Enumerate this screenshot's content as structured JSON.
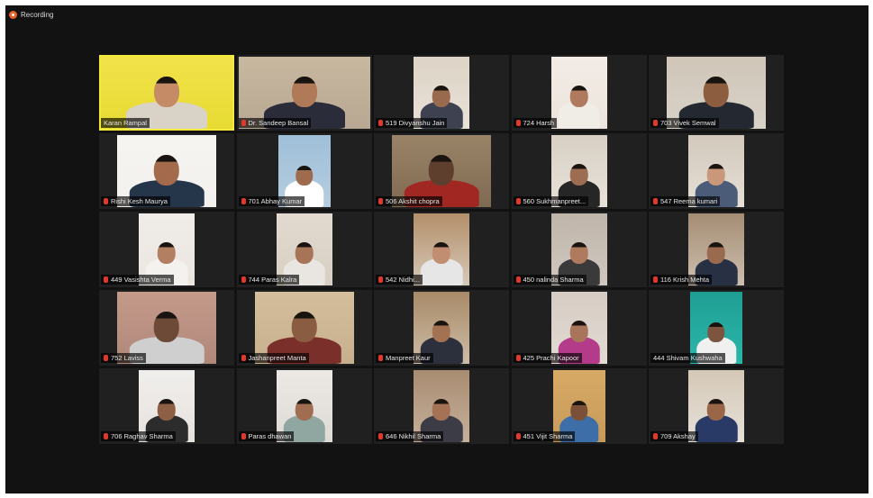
{
  "recording": {
    "label": "Recording",
    "color": "#e8622a"
  },
  "participants": [
    {
      "name": "Karan Rampal",
      "muted": false,
      "active": true
    },
    {
      "name": "Dr. Sandeep Bansal",
      "muted": true,
      "active": false
    },
    {
      "name": "519 Divyanshu Jain",
      "muted": true,
      "active": false
    },
    {
      "name": "724 Harsh",
      "muted": true,
      "active": false
    },
    {
      "name": "703 Vivek Semwal",
      "muted": true,
      "active": false
    },
    {
      "name": "Rishi Kesh Maurya",
      "muted": true,
      "active": false
    },
    {
      "name": "701 Abhay Kumar",
      "muted": true,
      "active": false
    },
    {
      "name": "506 Akshit chopra",
      "muted": true,
      "active": false
    },
    {
      "name": "560 Sukhmanpreet...",
      "muted": true,
      "active": false
    },
    {
      "name": "547 Reema kumari",
      "muted": true,
      "active": false
    },
    {
      "name": "449 Vasishta Verma",
      "muted": true,
      "active": false
    },
    {
      "name": "744 Paras Kalra",
      "muted": true,
      "active": false
    },
    {
      "name": "542 Nidhi...",
      "muted": true,
      "active": false
    },
    {
      "name": "450 nalinda Sharma",
      "muted": true,
      "active": false
    },
    {
      "name": "116 Krish Mehta",
      "muted": true,
      "active": false
    },
    {
      "name": "752 Laviss",
      "muted": true,
      "active": false
    },
    {
      "name": "Jashanpreet Manta",
      "muted": true,
      "active": false
    },
    {
      "name": "Manpreet Kaur",
      "muted": true,
      "active": false
    },
    {
      "name": "425 Prachi Kapoor",
      "muted": true,
      "active": false
    },
    {
      "name": "444 Shivam Kushwaha",
      "muted": false,
      "active": false
    },
    {
      "name": "706 Raghav Sharma",
      "muted": true,
      "active": false
    },
    {
      "name": "Paras dhawan",
      "muted": true,
      "active": false
    },
    {
      "name": "646 Nikhil Sharma",
      "muted": true,
      "active": false
    },
    {
      "name": "451 Vijit Sharma",
      "muted": true,
      "active": false
    },
    {
      "name": "709 Akshay",
      "muted": true,
      "active": false
    }
  ]
}
